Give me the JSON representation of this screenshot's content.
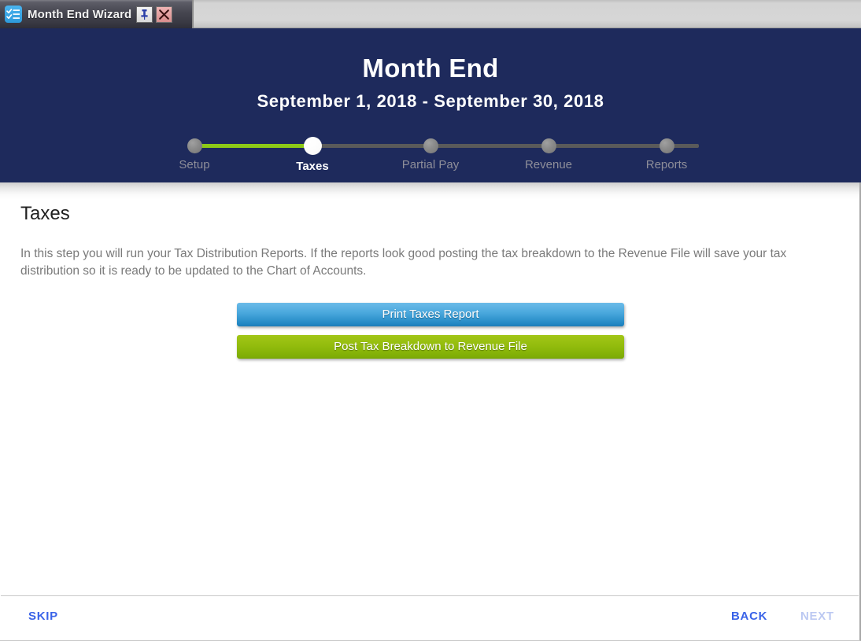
{
  "window": {
    "tab_title": "Month End Wizard",
    "app_icon": "checklist-icon",
    "pin_icon": "pushpin-icon",
    "close_icon": "close-x-icon"
  },
  "header": {
    "title": "Month End",
    "date_range": "September 1, 2018  -  September 30, 2018",
    "background_color": "#1e2a5c",
    "progress_color": "#8dc917"
  },
  "stepper": {
    "active_index": 1,
    "steps": [
      {
        "label": "Setup",
        "state": "complete"
      },
      {
        "label": "Taxes",
        "state": "active"
      },
      {
        "label": "Partial Pay",
        "state": "pending"
      },
      {
        "label": "Revenue",
        "state": "pending"
      },
      {
        "label": "Reports",
        "state": "pending"
      }
    ]
  },
  "content": {
    "title": "Taxes",
    "description": "In this step you will run your Tax Distribution Reports.  If the reports look good posting the tax breakdown to the Revenue File will save your tax distribution so it is ready to be updated to the Chart of Accounts.",
    "actions": [
      {
        "label": "Print Taxes Report",
        "color": "#2288c4"
      },
      {
        "label": "Post Tax Breakdown to Revenue File",
        "color": "#93bc0d"
      }
    ]
  },
  "footer": {
    "skip_label": "SKIP",
    "back_label": "BACK",
    "next_label": "NEXT",
    "link_color": "#3a63e8",
    "disabled_color": "#bcc9f2"
  }
}
